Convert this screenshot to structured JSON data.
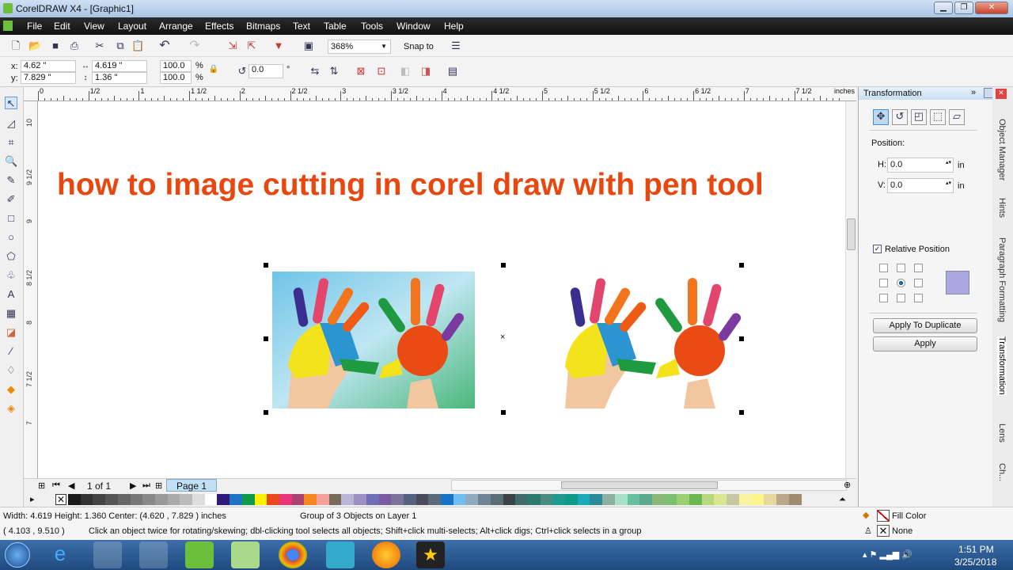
{
  "window": {
    "title": "CorelDRAW X4 - [Graphic1]"
  },
  "menu": [
    "File",
    "Edit",
    "View",
    "Layout",
    "Arrange",
    "Effects",
    "Bitmaps",
    "Text",
    "Table",
    "Tools",
    "Window",
    "Help"
  ],
  "toolbar": {
    "zoom": "368%",
    "snap_to": "Snap to"
  },
  "property_bar": {
    "x_label": "x:",
    "x": "4.62 \"",
    "y_label": "y:",
    "y": "7.829 \"",
    "width": "4.619 \"",
    "height": "1.36 \"",
    "scale_x": "100.0",
    "scale_y": "100.0",
    "percent": "%",
    "rotation": "0.0",
    "degree": "°"
  },
  "ruler": {
    "h_labels": [
      "0",
      "1/2",
      "1",
      "1 1/2",
      "2",
      "2 1/2",
      "3",
      "3 1/2",
      "4",
      "4 1/2",
      "5",
      "5 1/2",
      "6",
      "6 1/2",
      "7",
      "7 1/2"
    ],
    "units": "inches",
    "v_labels": [
      "10",
      "9 1/2",
      "9",
      "8 1/2",
      "8",
      "7 1/2",
      "7"
    ]
  },
  "canvas": {
    "heading": "how to image cutting in corel draw with pen tool",
    "heading_color": "#e8470f"
  },
  "page_nav": {
    "count": "1 of 1",
    "tab": "Page 1"
  },
  "palette": [
    "#1a1a1a",
    "#333",
    "#444",
    "#555",
    "#666",
    "#777",
    "#888",
    "#999",
    "#aaa",
    "#bbb",
    "#ddd",
    "#fff",
    "#2e1a7a",
    "#1f73c4",
    "#0e9a48",
    "#fff200",
    "#ea4a1b",
    "#e8357a",
    "#a8426e",
    "#f7861e",
    "#f79f9a",
    "#7a6a5a",
    "#b9b4d8",
    "#9d8fc4",
    "#6f6fb8",
    "#7a5aa0",
    "#7b739a",
    "#55627f",
    "#4a4a5a",
    "#5a6a7a",
    "#1672c4",
    "#72bdf0",
    "#8fa9c0",
    "#6f8596",
    "#5a6e78",
    "#3a4448",
    "#3f6b6a",
    "#2a7a70",
    "#4a8a80",
    "#1f9a90",
    "#0e9a8a",
    "#1aaab8",
    "#2a8a9a",
    "#8fb0a0",
    "#a7e0c8",
    "#66c0a0",
    "#5aaa90",
    "#8ab878",
    "#7ac070",
    "#9ad070",
    "#6ab850",
    "#b8d880",
    "#d8e890",
    "#c8c8a0",
    "#f8f4a0",
    "#fff48a",
    "#e8d8a0",
    "#bca888",
    "#a08a70"
  ],
  "status": {
    "dims": "Width: 4.619  Height: 1.360  Center: (4.620 , 7.829 )  inches",
    "selection": "Group of 3 Objects on Layer 1",
    "cursor": "( 4.103 , 9.510  )",
    "hint": "Click an object twice for rotating/skewing; dbl-clicking tool selects all objects; Shift+click multi-selects; Alt+click digs; Ctrl+click selects in a group",
    "fill": "Fill Color",
    "outline": "None"
  },
  "docker": {
    "title": "Transformation",
    "position_label": "Position:",
    "h_label": "H:",
    "h": "0.0",
    "v_label": "V:",
    "v": "0.0",
    "unit": "in",
    "relative": "Relative Position",
    "apply_dup": "Apply To Duplicate",
    "apply": "Apply",
    "tabs": [
      "Object Manager",
      "Hints",
      "Paragraph Formatting",
      "Transformation",
      "Lens",
      "Ch..."
    ]
  },
  "taskbar": {
    "time": "1:51 PM",
    "date": "3/25/2018"
  }
}
